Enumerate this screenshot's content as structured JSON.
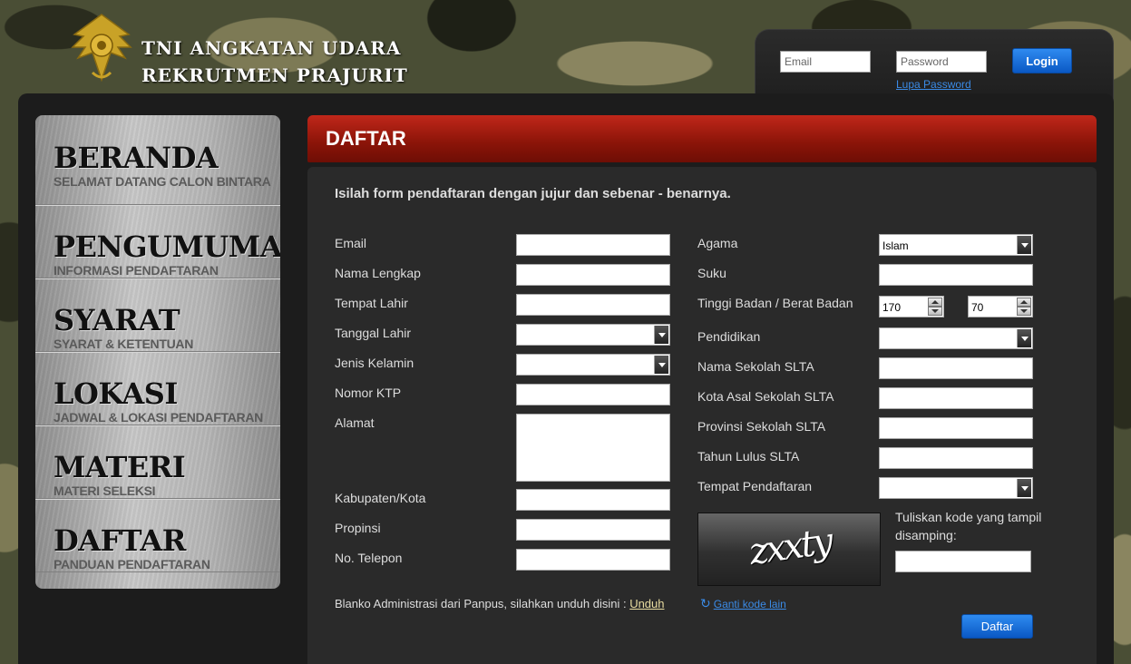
{
  "header": {
    "brand_line1": "TNI ANGKATAN UDARA",
    "brand_line2": "REKRUTMEN PRAJURIT",
    "login": {
      "email_placeholder": "Email",
      "password_placeholder": "Password",
      "login_label": "Login",
      "forgot_label": "Lupa Password"
    }
  },
  "sidebar": {
    "items": [
      {
        "title": "BERANDA",
        "subtitle": "SELAMAT DATANG CALON BINTARA"
      },
      {
        "title": "PENGUMUMAN",
        "subtitle": "INFORMASI PENDAFTARAN"
      },
      {
        "title": "SYARAT",
        "subtitle": "SYARAT & KETENTUAN"
      },
      {
        "title": "LOKASI",
        "subtitle": "JADWAL & LOKASI PENDAFTARAN"
      },
      {
        "title": "MATERI",
        "subtitle": "MATERI SELEKSI"
      },
      {
        "title": "DAFTAR",
        "subtitle": "PANDUAN PENDAFTARAN"
      }
    ]
  },
  "content": {
    "title": "DAFTAR",
    "intro": "Isilah form pendaftaran dengan jujur dan sebenar - benarnya.",
    "left_fields": {
      "email": "Email",
      "nama": "Nama Lengkap",
      "tempat_lahir": "Tempat Lahir",
      "tanggal_lahir": "Tanggal Lahir",
      "jenis_kelamin": "Jenis Kelamin",
      "ktp": "Nomor KTP",
      "alamat": "Alamat",
      "kabupaten": "Kabupaten/Kota",
      "propinsi": "Propinsi",
      "telepon": "No. Telepon"
    },
    "right_fields": {
      "agama": "Agama",
      "agama_value": "Islam",
      "suku": "Suku",
      "tinggi_berat": "Tinggi Badan / Berat Badan",
      "tinggi_value": "170",
      "berat_value": "70",
      "pendidikan": "Pendidikan",
      "sekolah": "Nama Sekolah SLTA",
      "kota_sekolah": "Kota Asal Sekolah SLTA",
      "provinsi_sekolah": "Provinsi Sekolah SLTA",
      "tahun_lulus": "Tahun Lulus SLTA",
      "tempat_pendaftaran": "Tempat Pendaftaran"
    },
    "captcha": {
      "text": "zxxty",
      "label": "Tuliskan kode yang tampil disamping:",
      "refresh_label": "Ganti kode lain"
    },
    "blanko_text": "Blanko Administrasi dari Panpus, silahkan unduh disini : ",
    "blanko_link": "Unduh",
    "submit_label": "Daftar"
  }
}
